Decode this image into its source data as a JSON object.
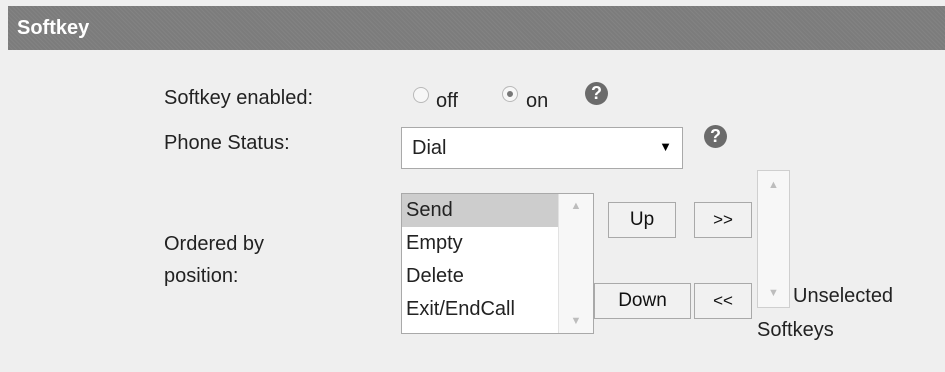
{
  "section": {
    "title": "Softkey"
  },
  "softkey_enabled": {
    "label": "Softkey enabled:",
    "options": [
      {
        "label": "off",
        "checked": false
      },
      {
        "label": "on",
        "checked": true
      }
    ],
    "help": "?"
  },
  "phone_status": {
    "label": "Phone Status:",
    "selected": "Dial",
    "arrow": "▼",
    "help": "?"
  },
  "ordered": {
    "label_line1": "Ordered by",
    "label_line2": "position:",
    "items": [
      "Send",
      "Empty",
      "Delete",
      "Exit/EndCall"
    ],
    "selected_index": 0
  },
  "buttons": {
    "up": "Up",
    "down": "Down",
    "add": ">>",
    "remove": "<<"
  },
  "unselected": {
    "label_line1": "Unselected",
    "label_line2": "Softkeys"
  },
  "icons": {
    "scroll_up": "▲",
    "scroll_down": "▼"
  }
}
